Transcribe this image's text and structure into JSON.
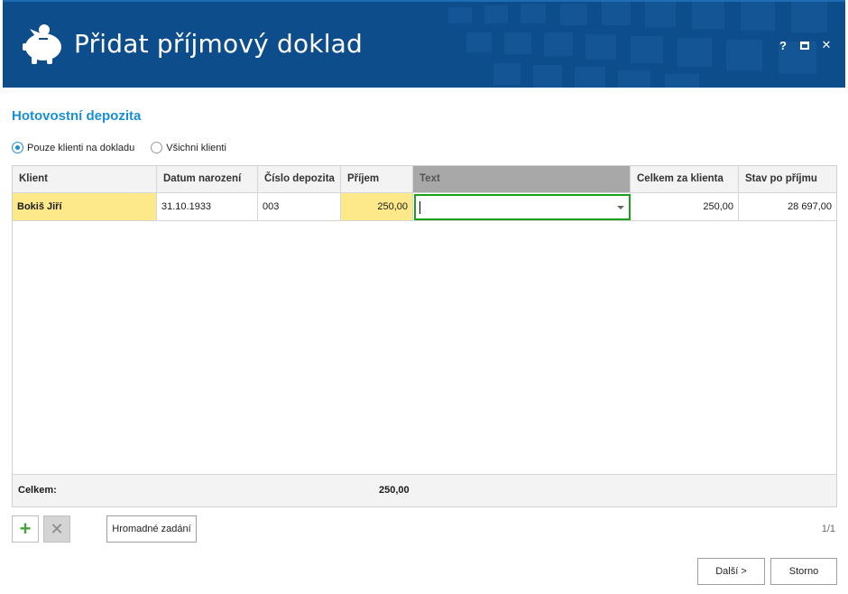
{
  "window": {
    "title": "Přidat příjmový doklad",
    "help_label": "?",
    "maximize_icon": "maximize-icon",
    "close_label": "✕",
    "logo_icon": "piggy-bank-icon",
    "header_color": "#0d4d8c"
  },
  "section": {
    "title": "Hotovostní depozita",
    "accent_color": "#1b8fd1"
  },
  "filter": {
    "options": [
      {
        "label": "Pouze klienti na dokladu",
        "selected": true
      },
      {
        "label": "Všichni klienti",
        "selected": false
      }
    ]
  },
  "table": {
    "columns": [
      "Klient",
      "Datum narození",
      "Číslo depozita",
      "Příjem",
      "Text",
      "Celkem za klienta",
      "Stav po příjmu"
    ],
    "active_column": "Text",
    "rows": [
      {
        "klient": "Bokiš Jiří",
        "datum": "31.10.1933",
        "cislo": "003",
        "prijem": "250,00",
        "text": "",
        "celkem": "250,00",
        "stav": "28 697,00"
      }
    ],
    "footer": {
      "label": "Celkem:",
      "prijem_total": "250,00"
    },
    "highlight_color": "#fde98a",
    "editor_border_color": "#1aa01a"
  },
  "toolbar": {
    "add_icon": "plus-icon",
    "delete_icon": "delete-icon",
    "bulk_label": "Hromadné zadání",
    "pager": "1/1"
  },
  "footer_buttons": {
    "next_label": "Další >",
    "cancel_label": "Storno"
  }
}
